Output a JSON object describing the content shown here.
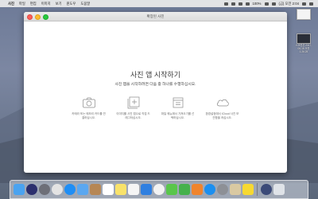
{
  "menubar": {
    "app_name": "사진",
    "items": [
      "파일",
      "편집",
      "이미지",
      "보기",
      "윈도우",
      "도움말"
    ],
    "battery": "100%",
    "clock": "(금) 오전 2:04"
  },
  "desktop": {
    "files": [
      {
        "caption": "",
        "icon": "screenshot-file-icon"
      },
      {
        "caption": "스크린샷 2017-06-16 오전 1.26.25",
        "icon": "screenshot-file-icon"
      }
    ]
  },
  "window": {
    "title": "확장된 사진",
    "heading": "사진 앱 시작하기",
    "subheading": "사진 앱을 시작하려면 다음 중 하나를 수행하십시오.",
    "options": [
      {
        "icon": "camera-icon",
        "label": "카메라 또는 메모리 카드를 연결하십시오."
      },
      {
        "icon": "import-photos-icon",
        "label": "이미지를 사진 앱으로 직접 드래그하십시오."
      },
      {
        "icon": "file-import-icon",
        "label": "파일 메뉴에서 가져오기를 선택하십시오."
      },
      {
        "icon": "icloud-icon",
        "label": "환경설정에서 iCloud 사진 보관함을 켜십시오."
      }
    ]
  },
  "dock": {
    "apps": [
      {
        "name": "finder-icon",
        "color": "#4aa3f0"
      },
      {
        "name": "siri-icon",
        "color": "#2b2f6e"
      },
      {
        "name": "launchpad-icon",
        "color": "#6d6f78"
      },
      {
        "name": "chrome-icon",
        "color": "#e3e3e3"
      },
      {
        "name": "safari-icon",
        "color": "#1f8ef5"
      },
      {
        "name": "mail-icon",
        "color": "#5aa7f0"
      },
      {
        "name": "contacts-icon",
        "color": "#b68755"
      },
      {
        "name": "calendar-icon",
        "color": "#ffffff"
      },
      {
        "name": "notes-icon",
        "color": "#f8e26a"
      },
      {
        "name": "reminders-icon",
        "color": "#f5f5f5"
      },
      {
        "name": "keynote-icon",
        "color": "#2f7fe0"
      },
      {
        "name": "photos-icon",
        "color": "#f2f2f2"
      },
      {
        "name": "messages-icon",
        "color": "#59c64b"
      },
      {
        "name": "facetime-icon",
        "color": "#45b14c"
      },
      {
        "name": "ibooks-icon",
        "color": "#f0842d"
      },
      {
        "name": "appstore-icon",
        "color": "#1b8ff0"
      },
      {
        "name": "system-preferences-icon",
        "color": "#8d9096"
      },
      {
        "name": "font-book-icon",
        "color": "#d9c9a2"
      },
      {
        "name": "kakaotalk-icon",
        "color": "#f7d931"
      },
      {
        "name": "downloads-icon",
        "color": "#3b4a78"
      },
      {
        "name": "trash-icon",
        "color": "#dfe3e8"
      }
    ]
  }
}
